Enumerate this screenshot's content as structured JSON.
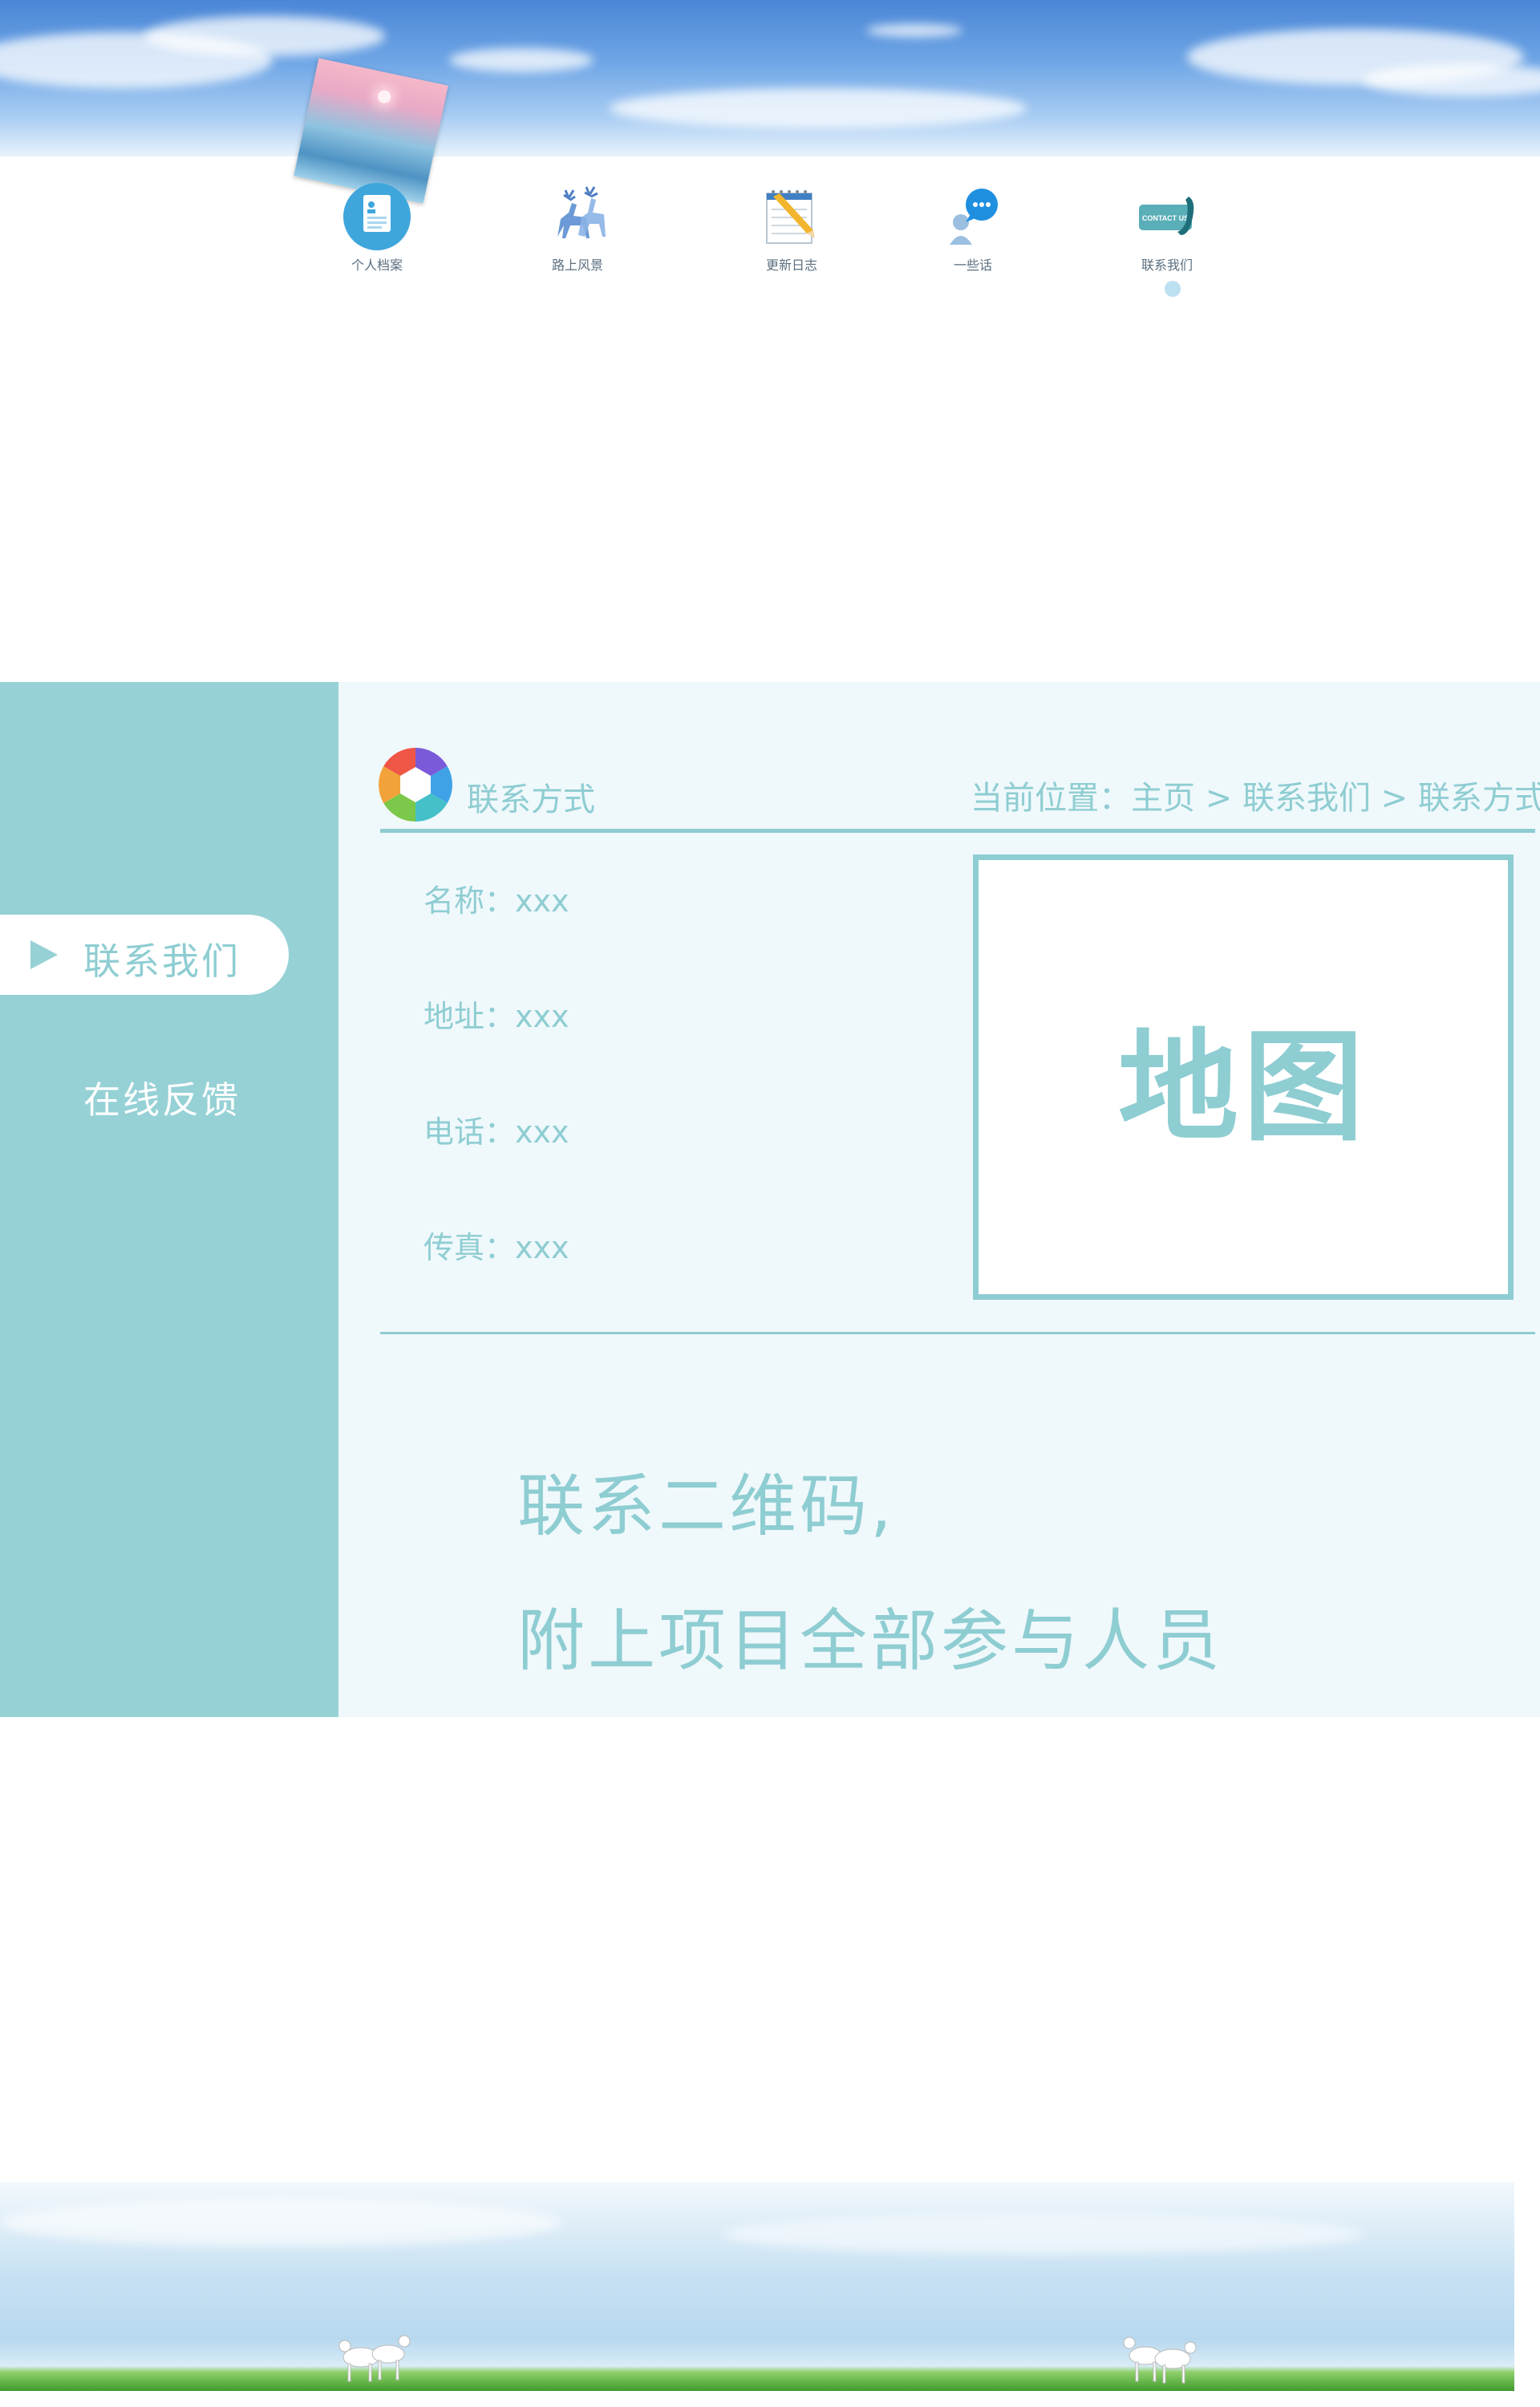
{
  "nav": {
    "items": [
      {
        "label": "个人档案",
        "icon": "profile-document-icon"
      },
      {
        "label": "路上风景",
        "icon": "deer-icon"
      },
      {
        "label": "更新日志",
        "icon": "notepad-pencil-icon"
      },
      {
        "label": "一些话",
        "icon": "chat-bubble-icon"
      },
      {
        "label": "联系我们",
        "icon": "contact-us-phone-icon"
      }
    ],
    "active_index": 4
  },
  "sidebar": {
    "items": [
      {
        "label": "联系我们",
        "active": true
      },
      {
        "label": "在线反馈",
        "active": false
      }
    ]
  },
  "section": {
    "title": "联系方式",
    "breadcrumb": "当前位置：主页 > 联系我们 > 联系方式"
  },
  "contact": {
    "name": "名称：xxx",
    "address": "地址：xxx",
    "phone": "电话：xxx",
    "fax": "传真：xxx"
  },
  "map": {
    "label": "地图"
  },
  "footer_text": {
    "line1": "联系二维码,",
    "line2": "附上项目全部参与人员"
  },
  "colors": {
    "accent": "#8ecdd2",
    "sidebar_bg": "#96d1d6",
    "panel_bg": "#eff8fb",
    "sky_blue": "#4a86d6"
  }
}
